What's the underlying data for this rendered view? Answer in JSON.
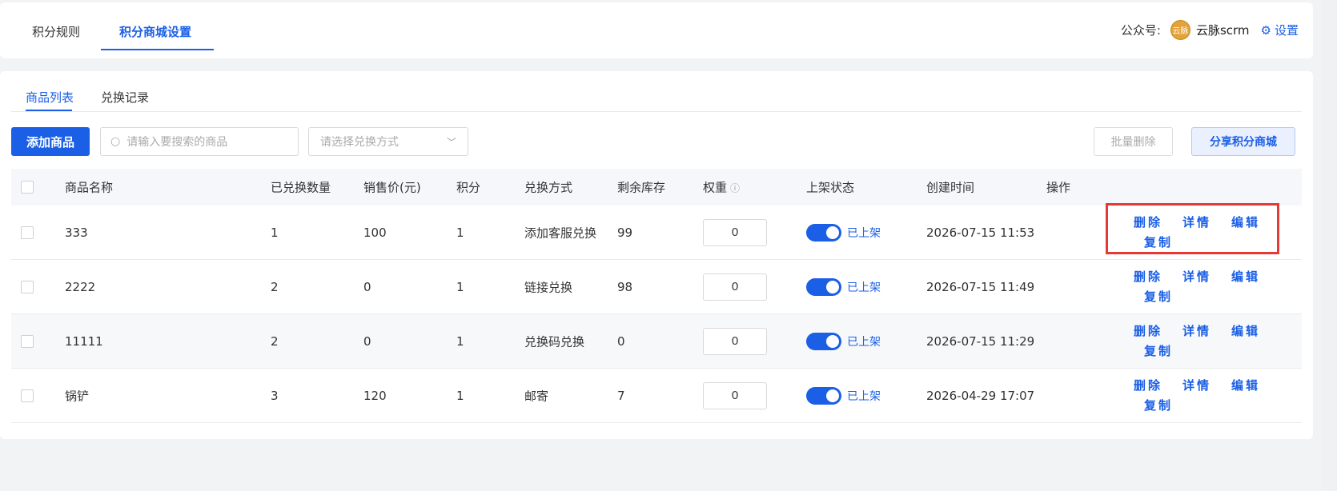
{
  "top_tabs": [
    "积分规则",
    "积分商城设置"
  ],
  "account": {
    "label": "公众号:",
    "avatar_text": "云脉",
    "name": "云脉scrm",
    "settings_label": "设置"
  },
  "sub_tabs": [
    "商品列表",
    "兑换记录"
  ],
  "toolbar": {
    "add_label": "添加商品",
    "search_placeholder": "请输入要搜索的商品",
    "select_placeholder": "请选择兑换方式",
    "batch_delete_label": "批量删除",
    "share_label": "分享积分商城"
  },
  "columns": [
    "商品名称",
    "已兑换数量",
    "销售价(元)",
    "积分",
    "兑换方式",
    "剩余库存",
    "权重",
    "上架状态",
    "创建时间",
    "操作"
  ],
  "rows": [
    {
      "name": "333",
      "redeemed": "1",
      "price": "100",
      "points": "1",
      "method": "添加客服兑换",
      "stock": "99",
      "weight": "0",
      "status": "已上架",
      "created": "2026-07-15 11:53"
    },
    {
      "name": "2222",
      "redeemed": "2",
      "price": "0",
      "points": "1",
      "method": "链接兑换",
      "stock": "98",
      "weight": "0",
      "status": "已上架",
      "created": "2026-07-15 11:49"
    },
    {
      "name": "11111",
      "redeemed": "2",
      "price": "0",
      "points": "1",
      "method": "兑换码兑换",
      "stock": "0",
      "weight": "0",
      "status": "已上架",
      "created": "2026-07-15 11:29"
    },
    {
      "name": "锅铲",
      "redeemed": "3",
      "price": "120",
      "points": "1",
      "method": "邮寄",
      "stock": "7",
      "weight": "0",
      "status": "已上架",
      "created": "2026-04-29 17:07"
    }
  ],
  "actions": {
    "delete": "删除",
    "detail": "详情",
    "edit": "编辑",
    "copy": "复制"
  },
  "colors": {
    "primary": "#1a5fe6",
    "highlight": "#e53935"
  }
}
